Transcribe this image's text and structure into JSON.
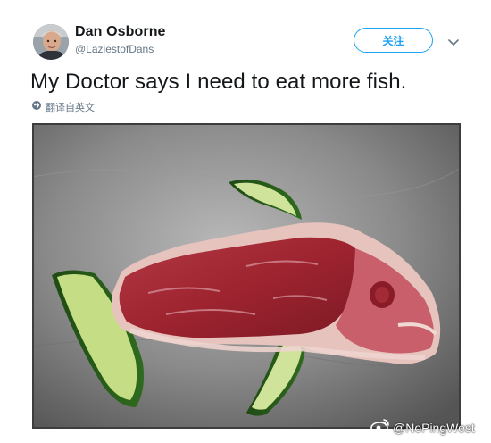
{
  "user": {
    "display_name": "Dan Osborne",
    "handle": "@LaziestofDans"
  },
  "header": {
    "follow_label": "关注"
  },
  "tweet": {
    "text": "My Doctor says I need to eat more fish.",
    "translate_label": "翻译自英文"
  },
  "watermark": {
    "text": "@NoPingWest"
  },
  "colors": {
    "accent": "#1da1f2",
    "text_primary": "#14171a",
    "text_secondary": "#657786"
  },
  "icons": {
    "header_menu": "chevron-down-icon",
    "translate": "globe-icon",
    "watermark": "weibo-logo-icon"
  }
}
